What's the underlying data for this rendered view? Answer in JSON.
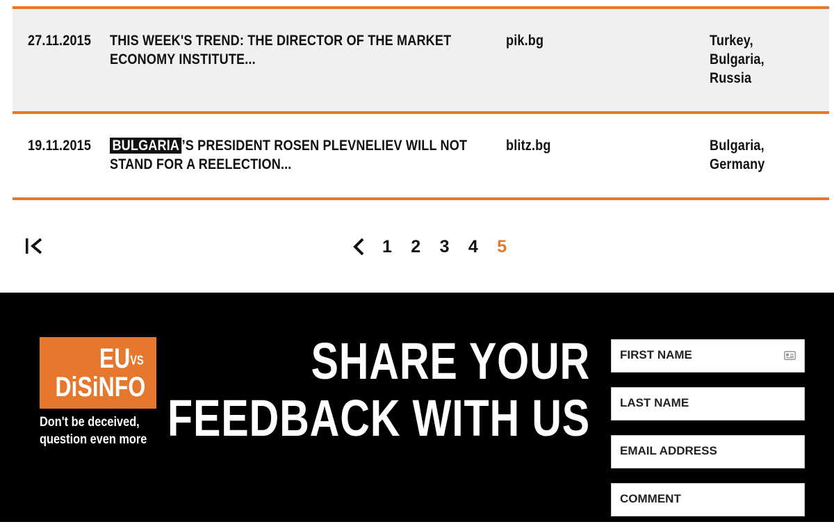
{
  "results": [
    {
      "date": "27.11.2015",
      "title_highlight": "",
      "title_rest": "THIS WEEK'S TREND: THE DIRECTOR OF THE MARKET ECONOMY INSTITUTE...",
      "source": "pik.bg",
      "countries": [
        "Turkey,",
        "Bulgaria,",
        "Russia"
      ]
    },
    {
      "date": "19.11.2015",
      "title_highlight": "BULGARIA",
      "title_rest": "’S PRESIDENT ROSEN PLEVNELIEV WILL NOT STAND FOR A REELECTION...",
      "source": "blitz.bg",
      "countries": [
        "Bulgaria,",
        "Germany"
      ]
    }
  ],
  "pagination": {
    "pages": [
      "1",
      "2",
      "3",
      "4",
      "5"
    ],
    "current": "5",
    "first_icon": "first-page-icon",
    "prev_icon": "chevron-left-icon"
  },
  "footer": {
    "logo_eu": "EU",
    "logo_vs": "VS",
    "logo_disinfo": "DiSiNFO",
    "tagline_line1": "Don't be deceived,",
    "tagline_line2": "question even more",
    "headline_line1": "SHARE YOUR",
    "headline_line2": "FEEDBACK WITH US",
    "form": {
      "first_name_placeholder": "FIRST NAME",
      "last_name_placeholder": "LAST NAME",
      "email_placeholder": "EMAIL ADDRESS",
      "comment_placeholder": "COMMENT"
    }
  },
  "colors": {
    "accent": "#e6782e",
    "footer_bg": "#000000",
    "row_bg": "#f0f0f0"
  }
}
